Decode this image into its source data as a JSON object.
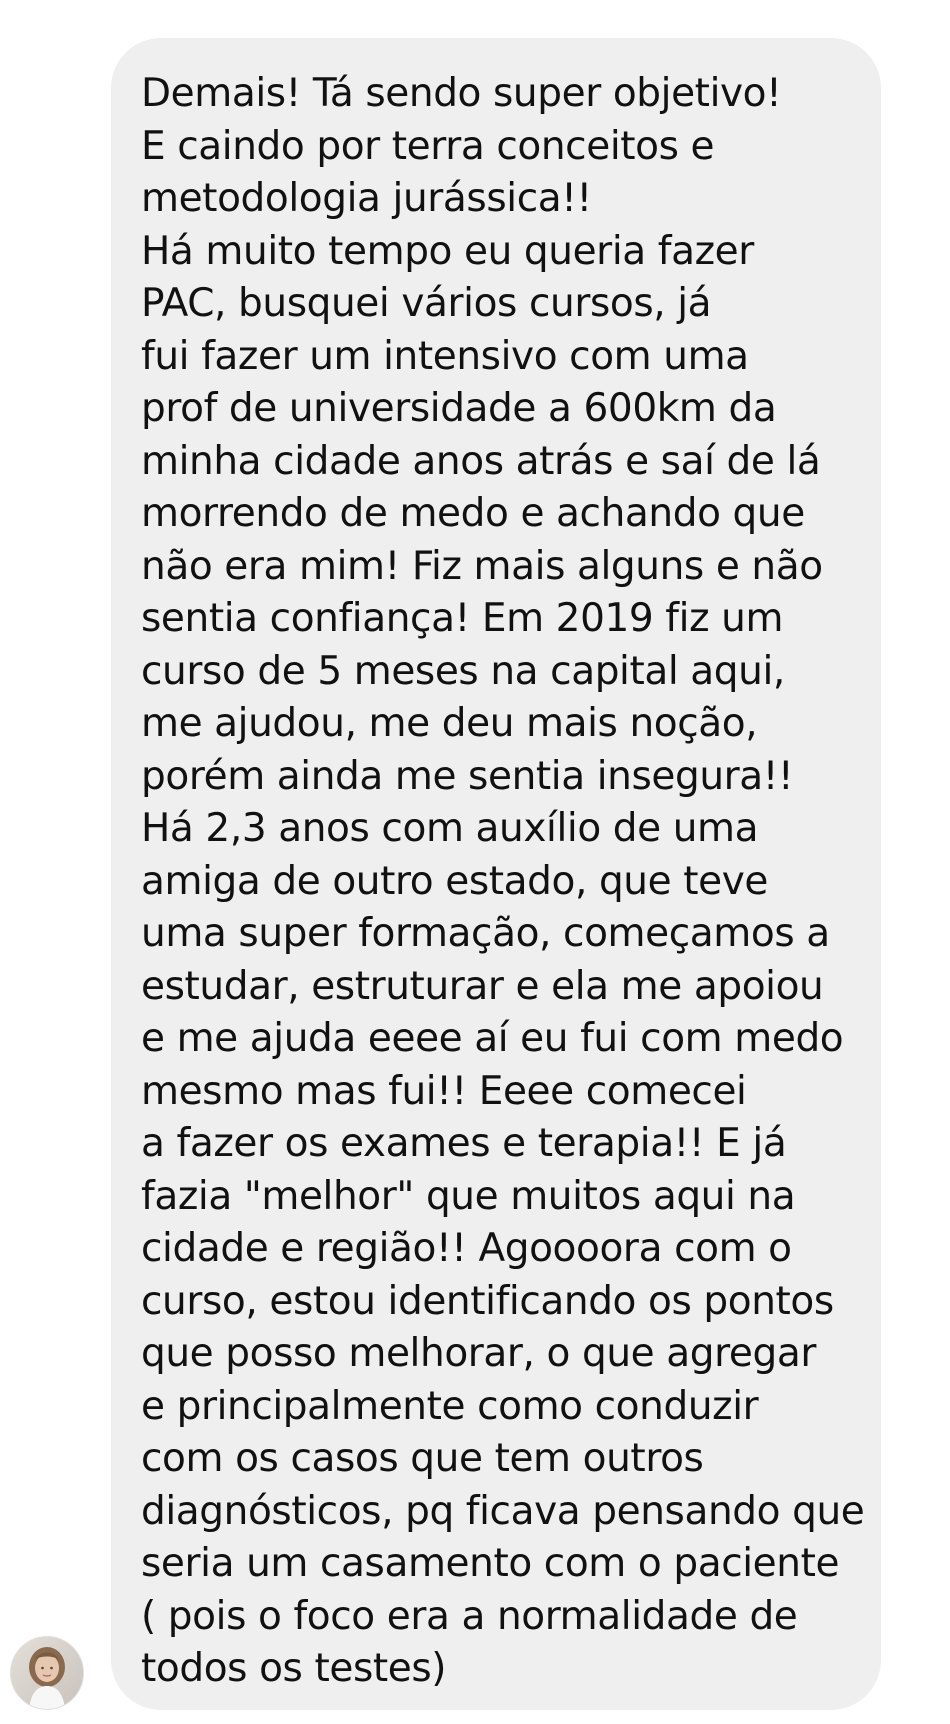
{
  "conversation": {
    "message": {
      "lines": [
        "Demais! Tá sendo super objetivo!",
        "E caindo por terra conceitos e",
        "metodologia jurássica!!",
        "Há muito tempo eu queria fazer",
        "PAC, busquei vários cursos, já",
        "fui fazer um intensivo com uma",
        "prof de universidade a 600km da",
        "minha cidade anos atrás e saí de lá",
        "morrendo de medo e achando que",
        "não era mim! Fiz mais alguns e não",
        "sentia confiança! Em 2019 fiz um",
        "curso de 5 meses na capital aqui,",
        "me ajudou, me deu mais noção,",
        "porém ainda me sentia insegura!!",
        "Há 2,3 anos com auxílio de uma",
        "amiga de outro estado, que teve",
        "uma super formação, começamos a",
        "estudar, estruturar e ela me apoiou",
        "e me ajuda eeee aí eu fui com medo",
        "mesmo mas fui!! Eeee comecei",
        "a fazer os exames e terapia!! E já",
        "fazia \"melhor\" que muitos aqui na",
        "cidade e região!! Agoooora com o",
        "curso, estou identificando os pontos",
        "que posso melhorar, o que agregar",
        "e principalmente como conduzir",
        "com os casos que tem outros",
        "diagnósticos, pq ficava pensando que",
        "seria um casamento com o paciente",
        "( pois o foco era a normalidade de",
        "todos os testes)"
      ]
    },
    "sender": {
      "avatar_icon": "profile-photo"
    }
  },
  "colors": {
    "bubble": "#efefef",
    "text": "#111111",
    "background": "#ffffff"
  }
}
